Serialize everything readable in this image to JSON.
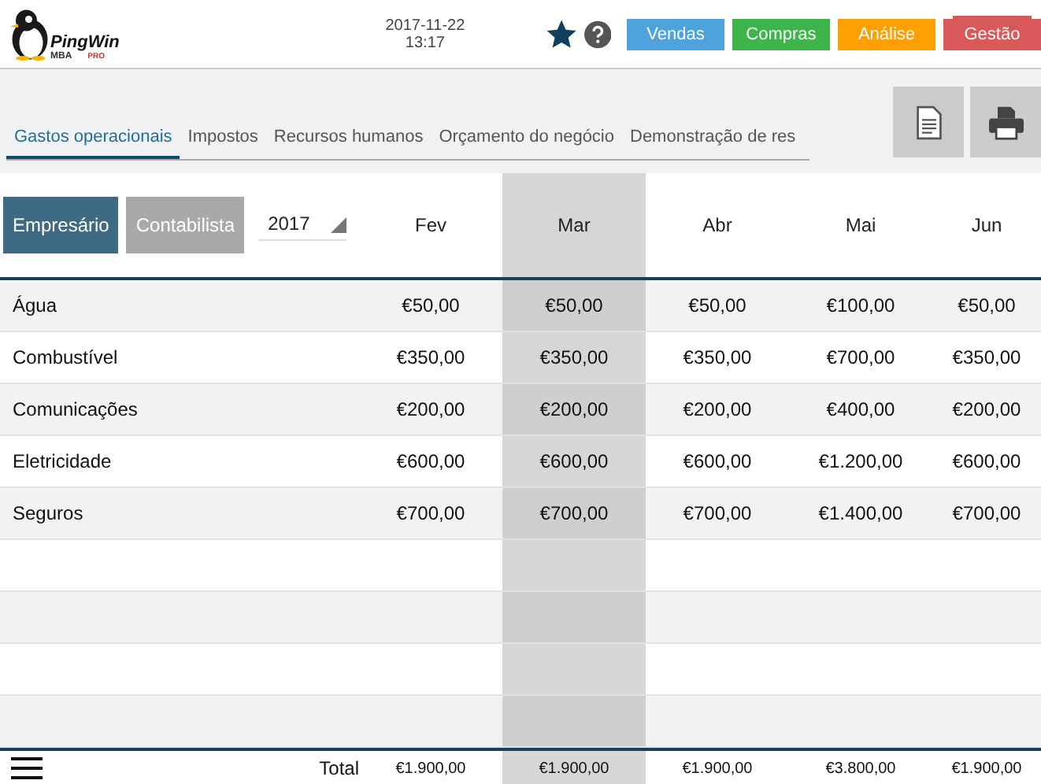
{
  "header": {
    "logo": {
      "name": "PingWin",
      "sub": "MBA",
      "badge": "PRO"
    },
    "date": "2017-11-22",
    "time": "13:17",
    "nav": [
      {
        "label": "Vendas",
        "color": "#4ea3dc",
        "selected": false
      },
      {
        "label": "Compras",
        "color": "#3db54a",
        "selected": false
      },
      {
        "label": "Análise",
        "color": "#ff9f00",
        "selected": false
      },
      {
        "label": "Gestão",
        "color": "#d9595b",
        "selected": true
      }
    ]
  },
  "tabs": [
    {
      "label": "Gastos operacionais",
      "selected": true
    },
    {
      "label": "Impostos",
      "selected": false
    },
    {
      "label": "Recursos humanos",
      "selected": false
    },
    {
      "label": "Orçamento do negócio",
      "selected": false
    },
    {
      "label": "Demonstração de res",
      "selected": false
    }
  ],
  "modes": [
    {
      "label": "Empresário",
      "selected": true
    },
    {
      "label": "Contabilista",
      "selected": false
    }
  ],
  "year": "2017",
  "table": {
    "columns": [
      {
        "label": "Fev",
        "selected": false
      },
      {
        "label": "Mar",
        "selected": true
      },
      {
        "label": "Abr",
        "selected": false
      },
      {
        "label": "Mai",
        "selected": false
      },
      {
        "label": "Jun",
        "selected": false
      }
    ],
    "rows": [
      {
        "name": "Água",
        "values": [
          "€50,00",
          "€50,00",
          "€50,00",
          "€100,00",
          "€50,00"
        ]
      },
      {
        "name": "Combustível",
        "values": [
          "€350,00",
          "€350,00",
          "€350,00",
          "€700,00",
          "€350,00"
        ]
      },
      {
        "name": "Comunicações",
        "values": [
          "€200,00",
          "€200,00",
          "€200,00",
          "€400,00",
          "€200,00"
        ]
      },
      {
        "name": "Eletricidade",
        "values": [
          "€600,00",
          "€600,00",
          "€600,00",
          "€1.200,00",
          "€600,00"
        ]
      },
      {
        "name": "Seguros",
        "values": [
          "€700,00",
          "€700,00",
          "€700,00",
          "€1.400,00",
          "€700,00"
        ]
      }
    ],
    "total": {
      "label": "Total",
      "values": [
        "€1.900,00",
        "€1.900,00",
        "€1.900,00",
        "€3.800,00",
        "€1.900,00"
      ]
    }
  }
}
